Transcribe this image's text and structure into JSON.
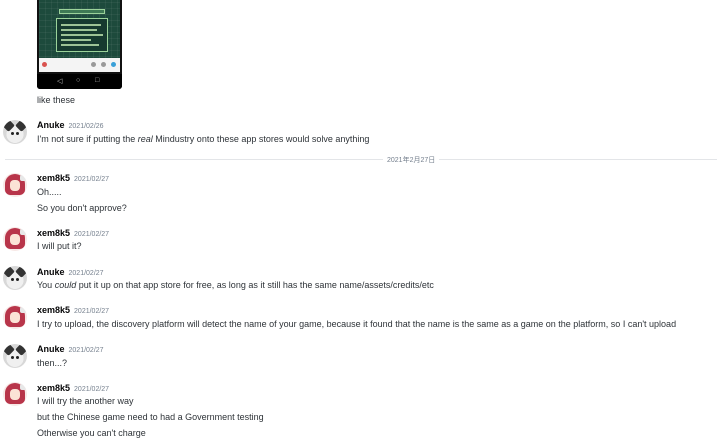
{
  "divider": {
    "date": "2021年2月27日"
  },
  "messages": [
    {
      "kind": "continuation",
      "text": "like these"
    },
    {
      "kind": "group",
      "avatar": "cat",
      "username": "Anuke",
      "timestamp": "2021/02/26",
      "lines": [
        {
          "pre": "I'm not sure if putting the ",
          "em": "real",
          "post": " Mindustry onto these app stores would solve anything"
        }
      ]
    },
    {
      "kind": "group",
      "avatar": "girl",
      "username": "xem8k5",
      "timestamp": "2021/02/27",
      "lines": [
        "Oh.....",
        "So you don't approve?"
      ]
    },
    {
      "kind": "group",
      "avatar": "girl",
      "username": "xem8k5",
      "timestamp": "2021/02/27",
      "lines": [
        "I will put it?"
      ]
    },
    {
      "kind": "group",
      "avatar": "cat",
      "username": "Anuke",
      "timestamp": "2021/02/27",
      "lines": [
        {
          "pre": "You ",
          "em": "could",
          "post": " put it up on that app store for free, as long as it still has the same name/assets/credits/etc"
        }
      ]
    },
    {
      "kind": "group",
      "avatar": "girl",
      "username": "xem8k5",
      "timestamp": "2021/02/27",
      "lines": [
        "I try to upload, the discovery platform will detect the name of your game, because it found that the name is the same as a game on the platform, so I can't upload"
      ]
    },
    {
      "kind": "group",
      "avatar": "cat",
      "username": "Anuke",
      "timestamp": "2021/02/27",
      "lines": [
        "then...?"
      ]
    },
    {
      "kind": "group",
      "avatar": "girl",
      "username": "xem8k5",
      "timestamp": "2021/02/27",
      "lines": [
        "I will try the another way",
        "but the Chinese game need to had a Government testing",
        "Otherwise you can't charge"
      ]
    }
  ],
  "icons": {
    "cat_avatar": "cat-avatar-icon",
    "girl_avatar": "anime-girl-avatar-icon"
  }
}
